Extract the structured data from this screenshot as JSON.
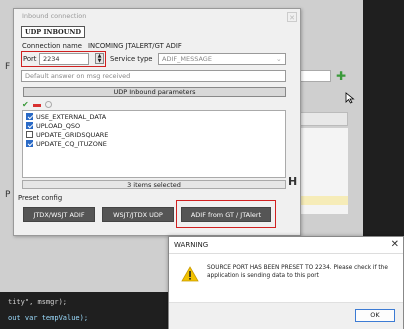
{
  "dialog": {
    "title": "Inbound connection",
    "tag": "UDP INBOUND",
    "connection_name_label": "Connection name",
    "connection_name_value": "INCOMING JTALERT/GT ADIF",
    "port_label": "Port",
    "port_value": "2234",
    "service_type_label": "Service type",
    "service_type_value": "ADIF_MESSAGE",
    "default_answer": "Default answer on msg received",
    "params_header": "UDP Inbound parameters",
    "params": [
      {
        "label": "USE_EXTERNAL_DATA",
        "checked": true
      },
      {
        "label": "UPLOAD_QSO",
        "checked": true
      },
      {
        "label": "UPDATE_GRIDSQUARE",
        "checked": false
      },
      {
        "label": "UPDATE_CQ_ITUZONE",
        "checked": true
      }
    ],
    "selected_count": "3 items selected",
    "preset_label": "Preset config",
    "presets": [
      "JTDX/WSJT ADIF",
      "WSJT/JTDX UDP",
      "ADIF from GT / JTAlert"
    ]
  },
  "background": {
    "letter_f": "F",
    "letter_p": "P",
    "code_line_1": "tity\", msmgr);",
    "code_line_2": "out var tempValue);"
  },
  "warning": {
    "title": "WARNING",
    "message": "SOURCE PORT HAS BEEN PRESET TO 2234. Please check if the application is sending data to this port",
    "ok": "OK"
  },
  "colors": {
    "highlight": "#d02020",
    "button_bg": "#555555",
    "checkbox_on": "#2a6ac6",
    "ok_border": "#3c7bd4"
  }
}
